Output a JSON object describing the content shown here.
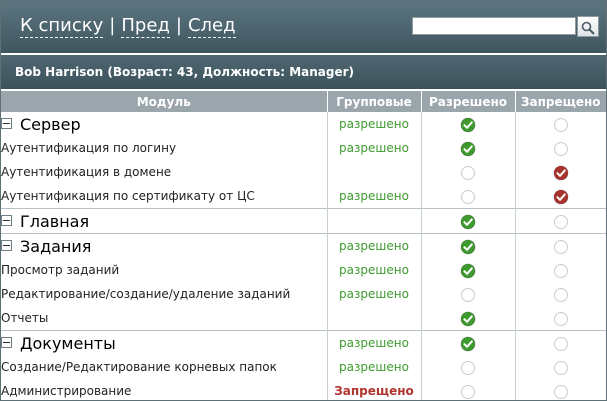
{
  "nav": {
    "back_to_list": "К списку",
    "prev": "Пред",
    "next": "След",
    "separator": "|"
  },
  "search": {
    "value": "",
    "placeholder": "",
    "icon": "magnifier-icon"
  },
  "user": {
    "title": "Bob Harrison (Возраст: 43, Должность: Manager)"
  },
  "table": {
    "headers": {
      "module": "Модуль",
      "group": "Групповые",
      "allowed": "Разрешено",
      "denied": "Запрещено"
    },
    "rows": [
      {
        "level": "group",
        "name": "Сервер",
        "group": "разрешено",
        "group_state": "allowed",
        "permission": "allowed"
      },
      {
        "level": "child",
        "name": "Аутентификация по логину",
        "group": "разрешено",
        "group_state": "allowed",
        "permission": "allowed"
      },
      {
        "level": "child",
        "name": "Аутентификация в домене",
        "group": "",
        "group_state": "",
        "permission": "denied"
      },
      {
        "level": "child",
        "name": "Аутентификация по сертификату от ЦС",
        "group": "разрешено",
        "group_state": "allowed",
        "permission": "denied"
      },
      {
        "level": "group",
        "name": "Главная",
        "group": "",
        "group_state": "",
        "permission": "allowed"
      },
      {
        "level": "group",
        "name": "Задания",
        "group": "разрешено",
        "group_state": "allowed",
        "permission": "allowed"
      },
      {
        "level": "child",
        "name": "Просмотр заданий",
        "group": "разрешено",
        "group_state": "allowed",
        "permission": "allowed"
      },
      {
        "level": "child",
        "name": "Редактирование/создание/удаление заданий",
        "group": "разрешено",
        "group_state": "allowed",
        "permission": "none"
      },
      {
        "level": "child",
        "name": "Отчеты",
        "group": "",
        "group_state": "",
        "permission": "allowed"
      },
      {
        "level": "group",
        "name": "Документы",
        "group": "разрешено",
        "group_state": "allowed",
        "permission": "allowed"
      },
      {
        "level": "child",
        "name": "Создание/Редактирование корневых папок",
        "group": "разрешено",
        "group_state": "allowed",
        "permission": "none"
      },
      {
        "level": "child",
        "name": "Администрирование",
        "group": "Запрещено",
        "group_state": "denied",
        "permission": "none"
      }
    ]
  },
  "colors": {
    "topbar": "#4f6771",
    "header_bg": "#9aa6ac",
    "allowed_text": "#3e9a2e",
    "denied_text": "#b0362e",
    "allowed_dot": "#3e9a2e",
    "denied_dot": "#a8322d"
  }
}
